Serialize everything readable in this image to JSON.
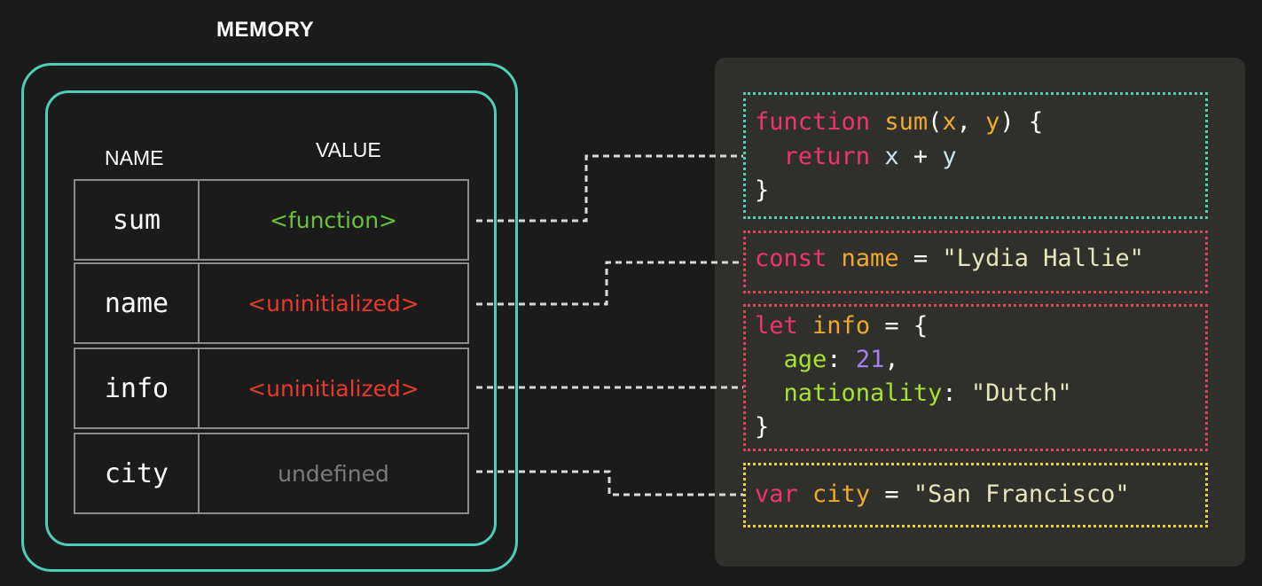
{
  "memory": {
    "title": "MEMORY",
    "headers": {
      "name": "NAME",
      "value": "VALUE"
    },
    "rows": [
      {
        "name": "sum",
        "value": "<function>",
        "value_color": "#6ac23b"
      },
      {
        "name": "name",
        "value": "<uninitialized>",
        "value_color": "#e83a2a"
      },
      {
        "name": "info",
        "value": "<uninitialized>",
        "value_color": "#e83a2a"
      },
      {
        "name": "city",
        "value": "undefined",
        "value_color": "#7c7c7c"
      }
    ]
  },
  "code": {
    "sum_block": {
      "border_color": "#4ecdb7",
      "line1": {
        "kw": "function",
        "fn": "sum",
        "p1": "(",
        "a": "x",
        "comma": ", ",
        "b": "y",
        "p2": ") {"
      },
      "line2": {
        "kw": "return",
        "a": "x",
        "op": " + ",
        "b": "y"
      },
      "line3": "}"
    },
    "name_block": {
      "border_color": "#e0465a",
      "line1": {
        "kw": "const",
        "id": "name",
        "op": " = ",
        "str": "\"Lydia Hallie\""
      }
    },
    "info_block": {
      "border_color": "#e0465a",
      "line1": {
        "kw": "let",
        "id": "info",
        "op": " = {"
      },
      "line2": {
        "prop": "age",
        "colon": ": ",
        "num": "21",
        "comma": ","
      },
      "line3": {
        "prop": "nationality",
        "colon": ": ",
        "str": "\"Dutch\""
      },
      "line4": "}"
    },
    "city_block": {
      "border_color": "#e8d43a",
      "line1": {
        "kw": "var",
        "id": "city",
        "op": " = ",
        "str": "\"San Francisco\""
      }
    }
  },
  "colors": {
    "background": "#1b1b1b",
    "memory_border": "#4ecdb7",
    "code_panel": "#2f302c",
    "connector": "#d8d8d8"
  }
}
